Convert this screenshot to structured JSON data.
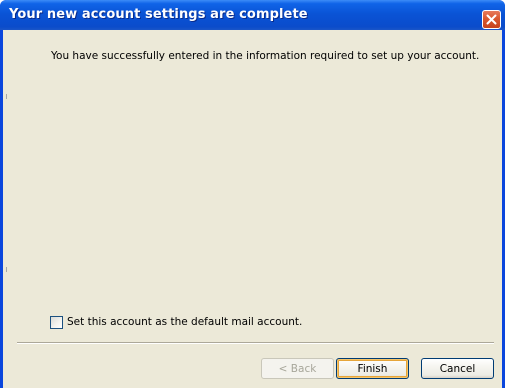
{
  "window": {
    "title": "Your new account settings are complete"
  },
  "content": {
    "message": "You have successfully entered in the information required to set up your account.",
    "default_account_checkbox": {
      "label": "Set this account as the default mail account.",
      "checked": false
    }
  },
  "buttons": {
    "back_label": "< Back",
    "back_enabled": false,
    "finish_label": "Finish",
    "cancel_label": "Cancel"
  },
  "colors": {
    "titlebar": "#0a54d6",
    "dialog_background": "#ece9d8",
    "close_button": "#d9582f",
    "button_border": "#003c74"
  },
  "icons": {
    "close": "close-icon"
  }
}
